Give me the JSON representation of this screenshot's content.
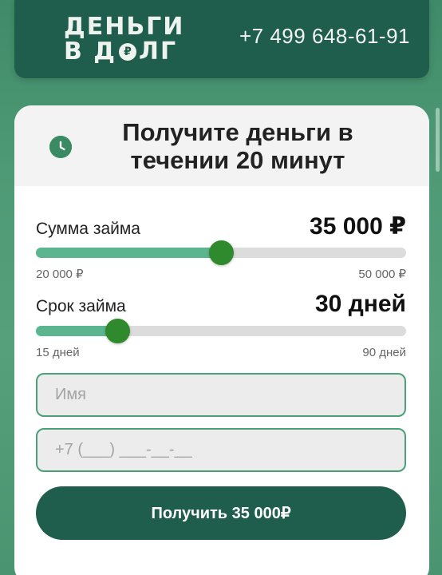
{
  "header": {
    "logo_line1": "ДЕНЬГИ",
    "logo_line2_a": "В Д",
    "logo_coin": "₽",
    "logo_line2_b": "ЛГ",
    "phone": "+7 499 648-61-91"
  },
  "card": {
    "title": "Получите деньги в течении 20 минут",
    "clock_icon": "clock-icon",
    "amount": {
      "label": "Сумма займа",
      "value": "35 000 ₽",
      "min_label": "20 000 ₽",
      "max_label": "50 000 ₽",
      "min": 20000,
      "max": 50000,
      "current": 35000
    },
    "term": {
      "label": "Срок займа",
      "value": "30 дней",
      "min_label": "15 дней",
      "max_label": "90 дней",
      "min": 15,
      "max": 90,
      "current": 30
    },
    "name_placeholder": "Имя",
    "phone_placeholder": "+7 (___) ___-__-__",
    "submit_label": "Получить 35 000₽"
  },
  "colors": {
    "brand_dark": "#1f5d4d",
    "accent_fill": "#5bb58f",
    "thumb": "#2e8a2c",
    "field_border": "#4aa077"
  }
}
